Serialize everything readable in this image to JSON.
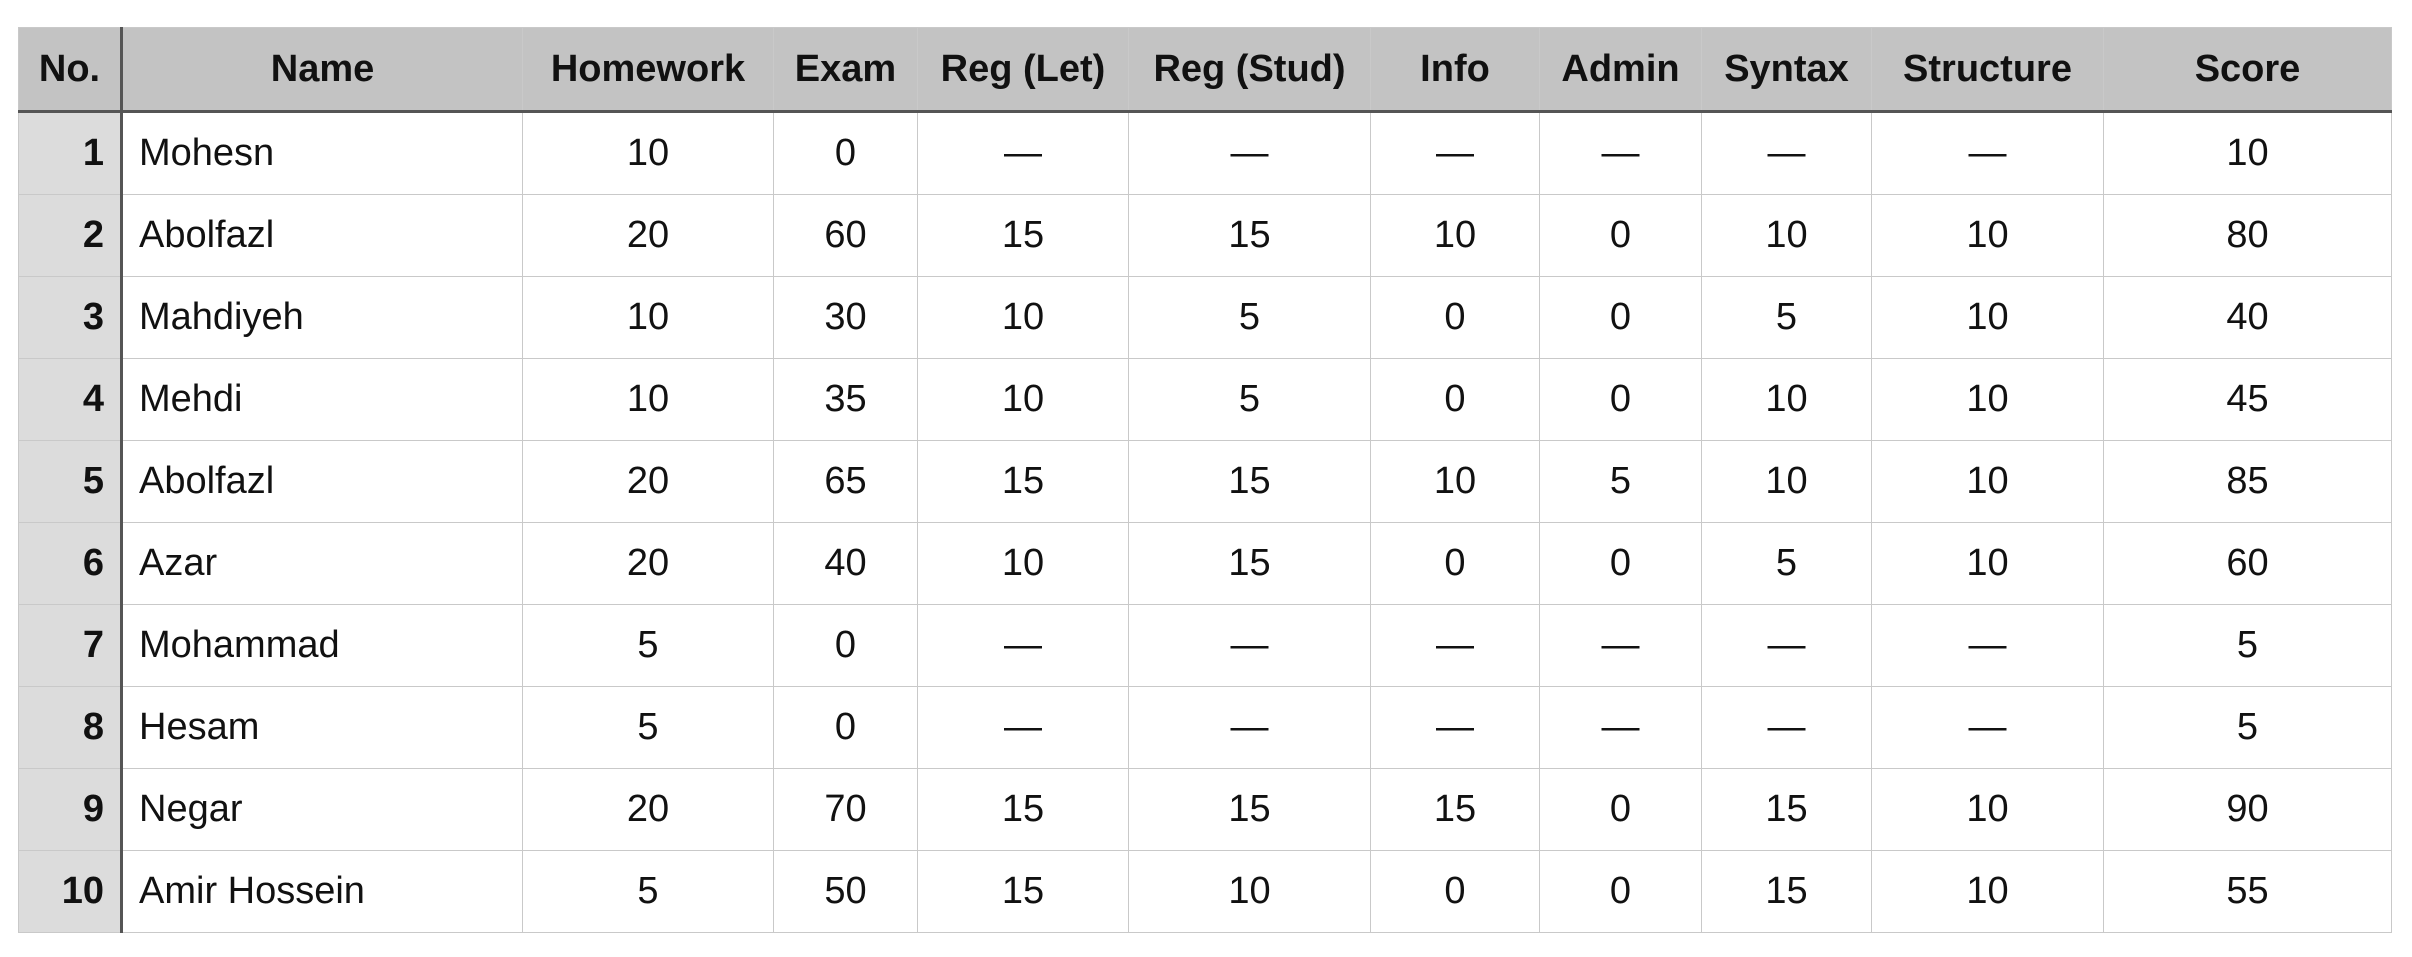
{
  "table": {
    "headers": [
      "No.",
      "Name",
      "Homework",
      "Exam",
      "Reg (Let)",
      "Reg (Stud)",
      "Info",
      "Admin",
      "Syntax",
      "Structure",
      "Score"
    ],
    "rows": [
      [
        "1",
        "Mohesn",
        "10",
        "0",
        "—",
        "—",
        "—",
        "—",
        "—",
        "—",
        "10"
      ],
      [
        "2",
        "Abolfazl",
        "20",
        "60",
        "15",
        "15",
        "10",
        "0",
        "10",
        "10",
        "80"
      ],
      [
        "3",
        "Mahdiyeh",
        "10",
        "30",
        "10",
        "5",
        "0",
        "0",
        "5",
        "10",
        "40"
      ],
      [
        "4",
        "Mehdi",
        "10",
        "35",
        "10",
        "5",
        "0",
        "0",
        "10",
        "10",
        "45"
      ],
      [
        "5",
        "Abolfazl",
        "20",
        "65",
        "15",
        "15",
        "10",
        "5",
        "10",
        "10",
        "85"
      ],
      [
        "6",
        "Azar",
        "20",
        "40",
        "10",
        "15",
        "0",
        "0",
        "5",
        "10",
        "60"
      ],
      [
        "7",
        "Mohammad",
        "5",
        "0",
        "—",
        "—",
        "—",
        "—",
        "—",
        "—",
        "5"
      ],
      [
        "8",
        "Hesam",
        "5",
        "0",
        "—",
        "—",
        "—",
        "—",
        "—",
        "—",
        "5"
      ],
      [
        "9",
        "Negar",
        "20",
        "70",
        "15",
        "15",
        "15",
        "0",
        "15",
        "10",
        "90"
      ],
      [
        "10",
        "Amir Hossein",
        "5",
        "50",
        "15",
        "10",
        "0",
        "0",
        "15",
        "10",
        "55"
      ]
    ]
  },
  "colors": {
    "header_bg": "#c3c3c3",
    "row_number_bg": "#dcdcdc",
    "grid_line": "#c9c9c9",
    "heavy_line": "#555555"
  }
}
